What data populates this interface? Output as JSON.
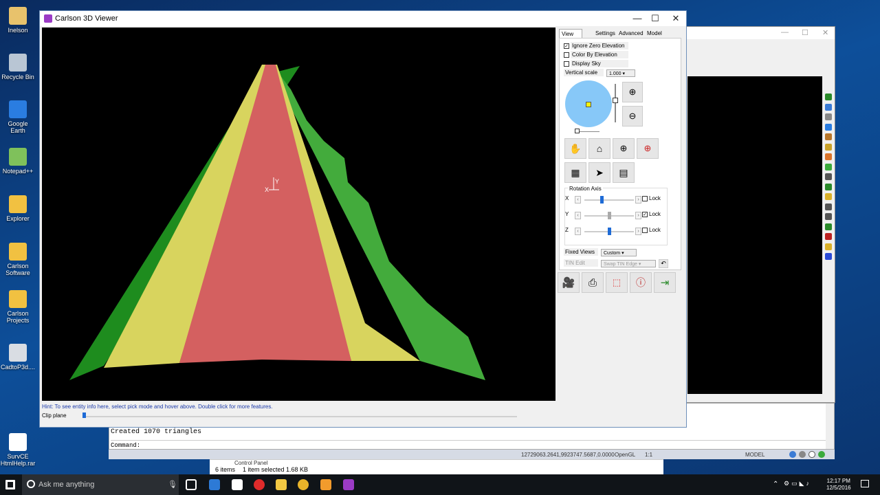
{
  "desktop_icons": [
    {
      "label": "Inelson",
      "color": "#e8c26c"
    },
    {
      "label": "Recycle Bin",
      "color": "#b9c6d4"
    },
    {
      "label": "Google Earth",
      "color": "#2a7de1"
    },
    {
      "label": "Notepad++",
      "color": "#7fc15b"
    },
    {
      "label": "Explorer",
      "color": "#f1c141"
    },
    {
      "label": "Carlson Software",
      "color": "#f1c141"
    },
    {
      "label": "Carlson Projects",
      "color": "#f1c141"
    },
    {
      "label": "CadtoP3d....",
      "color": "#d9dde3"
    },
    {
      "label": "SurvCE HtmlHelp.rar",
      "color": "#ffffff"
    }
  ],
  "main_window": {
    "title": "Carlson 3D Viewer",
    "minimize": "—",
    "maximize": "☐",
    "close": "✕",
    "hint": "Hint: To see entity info here, select pick mode and hover above. Double click for more features.",
    "clip_plane_label": "Clip plane",
    "clip_plane_value": 0.0,
    "cursor_label": "Y",
    "cursor_label_x": "X"
  },
  "panel": {
    "tabs": [
      "View Control",
      "Settings",
      "Advanced",
      "Model"
    ],
    "active_tab": "View Control",
    "checkboxes": [
      {
        "label": "Ignore Zero Elevation",
        "checked": true
      },
      {
        "label": "Color By Elevation",
        "checked": false
      },
      {
        "label": "Display Sky",
        "checked": false
      }
    ],
    "vertical_scale_label": "Vertical scale",
    "vertical_scale_value": "1.000",
    "rotation_axis_label": "Rotation Axis",
    "axes": [
      {
        "name": "X",
        "lock_label": "Lock",
        "locked": false,
        "value": 0.35
      },
      {
        "name": "Y",
        "lock_label": "Lock",
        "locked": true,
        "value": 0.5
      },
      {
        "name": "Z",
        "lock_label": "Lock",
        "locked": false,
        "value": 0.5
      }
    ],
    "fixed_views_label": "Fixed Views",
    "fixed_views_value": "Custom",
    "tin_edit_label": "TIN Edit",
    "tin_edit_value": "Swap TIN Edge"
  },
  "command_window": {
    "line1": "Created 1070 triangles",
    "prompt": "Command:"
  },
  "status_bar": {
    "coords": "12729063.2641,9923747.5687,0.0000",
    "renderer": "OpenGL",
    "scale": "1:1",
    "model": "MODEL"
  },
  "explorer_bar": {
    "title": "Control Panel",
    "items_count": "6 items",
    "selection": "1 item selected  1.68 KB"
  },
  "taskbar": {
    "search_placeholder": "Ask me anything",
    "time": "12:17 PM",
    "date": "12/5/2016"
  },
  "colors": {
    "terrain_red": "#d46060",
    "terrain_yellow": "#d8d45e",
    "terrain_green": "#43ab3c",
    "terrain_dark_green": "#1e8c1e",
    "view_sphere": "#87c8f8"
  }
}
